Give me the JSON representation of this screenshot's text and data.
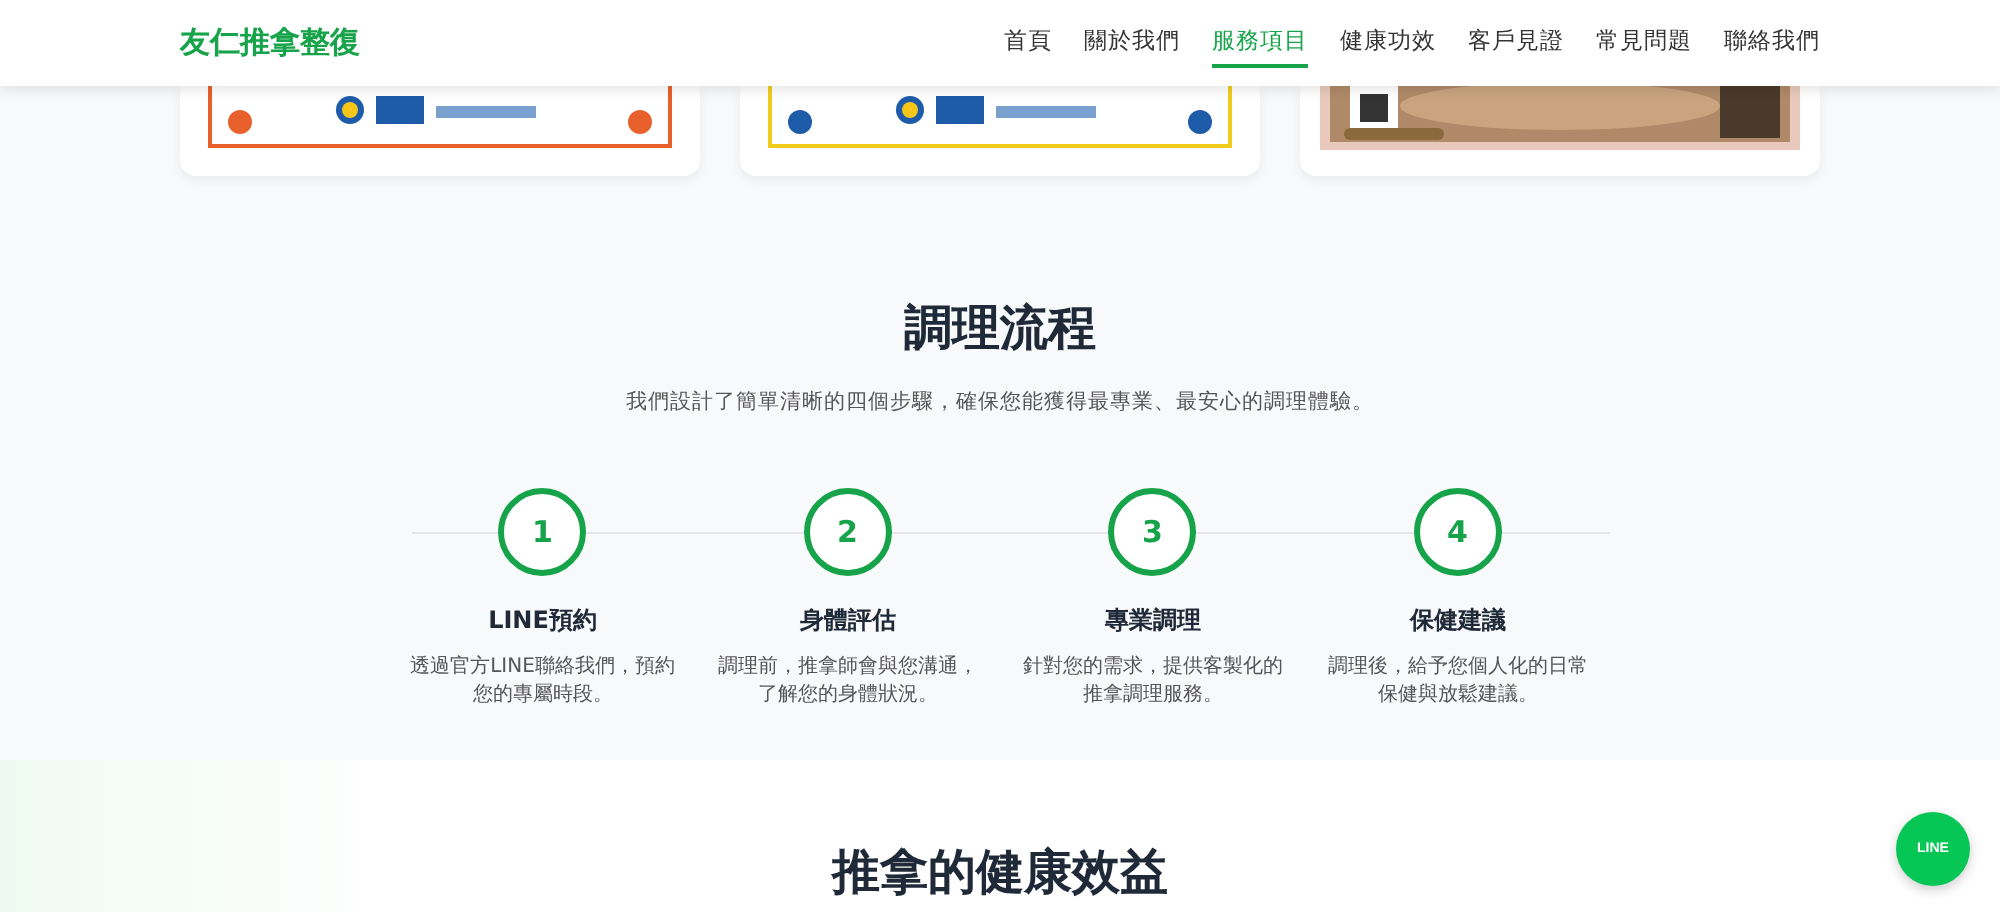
{
  "header": {
    "logo": "友仁推拿整復",
    "nav": [
      {
        "label": "首頁",
        "selected": false
      },
      {
        "label": "關於我們",
        "selected": false
      },
      {
        "label": "服務項目",
        "selected": true
      },
      {
        "label": "健康功效",
        "selected": false
      },
      {
        "label": "客戶見證",
        "selected": false
      },
      {
        "label": "常見問題",
        "selected": false
      },
      {
        "label": "聯絡我們",
        "selected": false
      }
    ]
  },
  "process": {
    "title": "調理流程",
    "subtitle": "我們設計了簡單清晰的四個步驟，確保您能獲得最專業、最安心的調理體驗。",
    "steps": [
      {
        "number": "1",
        "title": "LINE預約",
        "description": "透過官方LINE聯絡我們，預約您的專屬時段。"
      },
      {
        "number": "2",
        "title": "身體評估",
        "description": "調理前，推拿師會與您溝通，了解您的身體狀況。"
      },
      {
        "number": "3",
        "title": "專業調理",
        "description": "針對您的需求，提供客製化的推拿調理服務。"
      },
      {
        "number": "4",
        "title": "保健建議",
        "description": "調理後，給予您個人化的日常保健與放鬆建議。"
      }
    ]
  },
  "benefits": {
    "title": "推拿的健康效益"
  },
  "line_button": {
    "label": "LINE"
  }
}
